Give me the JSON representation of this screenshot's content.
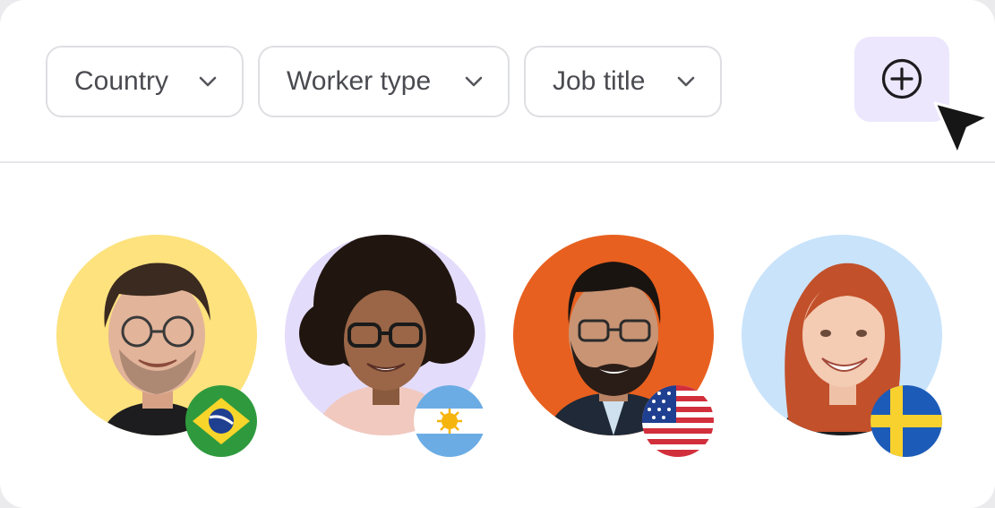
{
  "filters": [
    {
      "label": "Country",
      "icon": "chevron-down-icon"
    },
    {
      "label": "Worker type",
      "icon": "chevron-down-icon"
    },
    {
      "label": "Job title",
      "icon": "chevron-down-icon"
    }
  ],
  "add_button": {
    "icon": "plus-circle-icon",
    "background": "#ece7fd"
  },
  "pointer": {
    "icon": "mouse-pointer-icon"
  },
  "people": [
    {
      "avatar_bg": "#fde27e",
      "flag": "brazil-flag-icon"
    },
    {
      "avatar_bg": "#e4dcfb",
      "flag": "argentina-flag-icon"
    },
    {
      "avatar_bg": "#e8601f",
      "flag": "usa-flag-icon"
    },
    {
      "avatar_bg": "#c9e3fb",
      "flag": "sweden-flag-icon"
    }
  ]
}
